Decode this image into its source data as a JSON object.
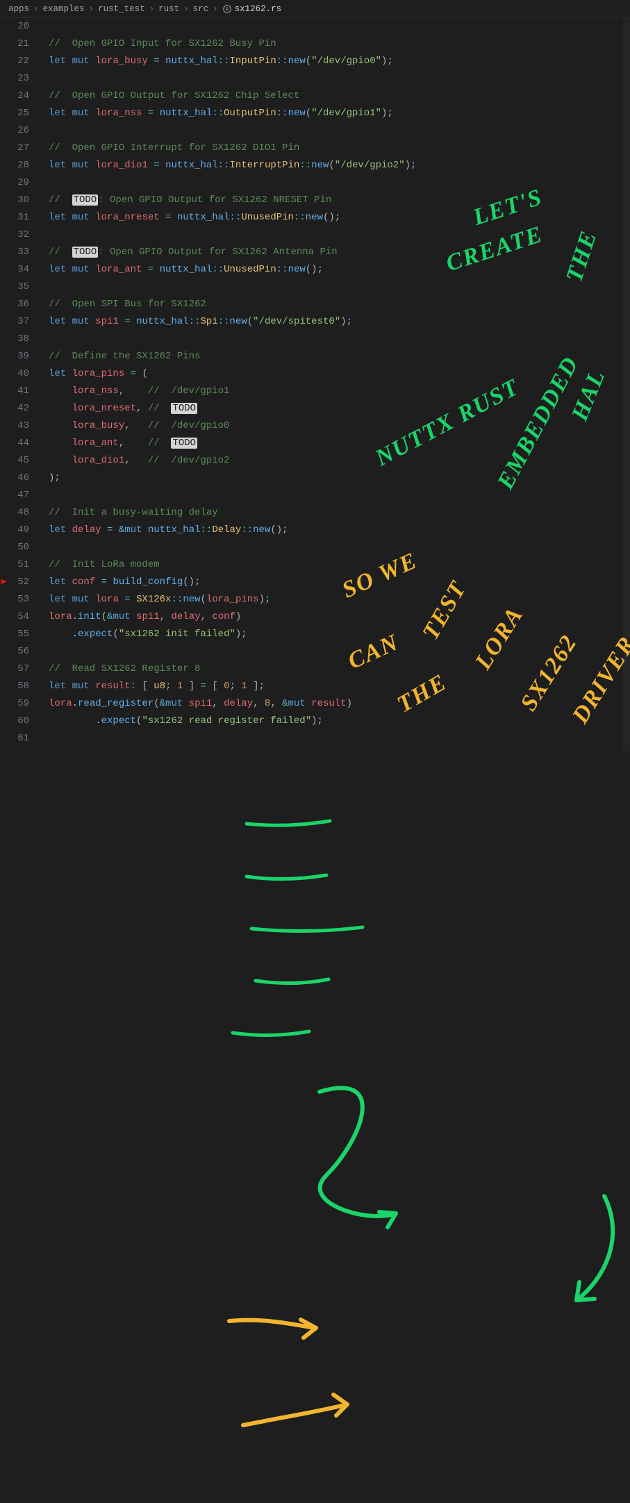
{
  "breadcrumb": {
    "parts": [
      "apps",
      "examples",
      "rust_test",
      "rust",
      "src"
    ],
    "file": "sx1262.rs"
  },
  "gutter": {
    "start": 20,
    "end": 61
  },
  "breakpoint_line": 52,
  "code": {
    "20": [],
    "21": [
      [
        "c",
        "//  Open GPIO Input for SX1262 Busy Pin"
      ]
    ],
    "22": [
      [
        "kw",
        "let"
      ],
      [
        "pn",
        " "
      ],
      [
        "kw",
        "mut"
      ],
      [
        "pn",
        " "
      ],
      [
        "id",
        "lora_busy"
      ],
      [
        "pn",
        " "
      ],
      [
        "op",
        "="
      ],
      [
        "pn",
        " "
      ],
      [
        "ns",
        "nuttx_hal"
      ],
      [
        "op",
        "::"
      ],
      [
        "ty",
        "InputPin"
      ],
      [
        "op",
        "::"
      ],
      [
        "fn",
        "new"
      ],
      [
        "pn",
        "("
      ],
      [
        "st",
        "\"/dev/gpio0\""
      ],
      [
        "pn",
        ");"
      ]
    ],
    "23": [],
    "24": [
      [
        "c",
        "//  Open GPIO Output for SX1262 Chip Select"
      ]
    ],
    "25": [
      [
        "kw",
        "let"
      ],
      [
        "pn",
        " "
      ],
      [
        "kw",
        "mut"
      ],
      [
        "pn",
        " "
      ],
      [
        "id",
        "lora_nss"
      ],
      [
        "pn",
        " "
      ],
      [
        "op",
        "="
      ],
      [
        "pn",
        " "
      ],
      [
        "ns",
        "nuttx_hal"
      ],
      [
        "op",
        "::"
      ],
      [
        "ty",
        "OutputPin"
      ],
      [
        "op",
        "::"
      ],
      [
        "fn",
        "new"
      ],
      [
        "pn",
        "("
      ],
      [
        "st",
        "\"/dev/gpio1\""
      ],
      [
        "pn",
        ");"
      ]
    ],
    "26": [],
    "27": [
      [
        "c",
        "//  Open GPIO Interrupt for SX1262 DIO1 Pin"
      ]
    ],
    "28": [
      [
        "kw",
        "let"
      ],
      [
        "pn",
        " "
      ],
      [
        "kw",
        "mut"
      ],
      [
        "pn",
        " "
      ],
      [
        "id",
        "lora_dio1"
      ],
      [
        "pn",
        " "
      ],
      [
        "op",
        "="
      ],
      [
        "pn",
        " "
      ],
      [
        "ns",
        "nuttx_hal"
      ],
      [
        "op",
        "::"
      ],
      [
        "ty",
        "InterruptPin"
      ],
      [
        "op",
        "::"
      ],
      [
        "fn",
        "new"
      ],
      [
        "pn",
        "("
      ],
      [
        "st",
        "\"/dev/gpio2\""
      ],
      [
        "pn",
        ");"
      ]
    ],
    "29": [],
    "30": [
      [
        "c",
        "//  "
      ],
      [
        "todo",
        "TODO"
      ],
      [
        "c",
        ": Open GPIO Output for SX1262 NRESET Pin"
      ]
    ],
    "31": [
      [
        "kw",
        "let"
      ],
      [
        "pn",
        " "
      ],
      [
        "kw",
        "mut"
      ],
      [
        "pn",
        " "
      ],
      [
        "id",
        "lora_nreset"
      ],
      [
        "pn",
        " "
      ],
      [
        "op",
        "="
      ],
      [
        "pn",
        " "
      ],
      [
        "ns",
        "nuttx_hal"
      ],
      [
        "op",
        "::"
      ],
      [
        "ty",
        "UnusedPin"
      ],
      [
        "op",
        "::"
      ],
      [
        "fn",
        "new"
      ],
      [
        "pn",
        "();"
      ]
    ],
    "32": [],
    "33": [
      [
        "c",
        "//  "
      ],
      [
        "todo",
        "TODO"
      ],
      [
        "c",
        ": Open GPIO Output for SX1262 Antenna Pin"
      ]
    ],
    "34": [
      [
        "kw",
        "let"
      ],
      [
        "pn",
        " "
      ],
      [
        "kw",
        "mut"
      ],
      [
        "pn",
        " "
      ],
      [
        "id",
        "lora_ant"
      ],
      [
        "pn",
        " "
      ],
      [
        "op",
        "="
      ],
      [
        "pn",
        " "
      ],
      [
        "ns",
        "nuttx_hal"
      ],
      [
        "op",
        "::"
      ],
      [
        "ty",
        "UnusedPin"
      ],
      [
        "op",
        "::"
      ],
      [
        "fn",
        "new"
      ],
      [
        "pn",
        "();"
      ]
    ],
    "35": [],
    "36": [
      [
        "c",
        "//  Open SPI Bus for SX1262"
      ]
    ],
    "37": [
      [
        "kw",
        "let"
      ],
      [
        "pn",
        " "
      ],
      [
        "kw",
        "mut"
      ],
      [
        "pn",
        " "
      ],
      [
        "id",
        "spi1"
      ],
      [
        "pn",
        " "
      ],
      [
        "op",
        "="
      ],
      [
        "pn",
        " "
      ],
      [
        "ns",
        "nuttx_hal"
      ],
      [
        "op",
        "::"
      ],
      [
        "ty",
        "Spi"
      ],
      [
        "op",
        "::"
      ],
      [
        "fn",
        "new"
      ],
      [
        "pn",
        "("
      ],
      [
        "st",
        "\"/dev/spitest0\""
      ],
      [
        "pn",
        ");"
      ]
    ],
    "38": [],
    "39": [
      [
        "c",
        "//  Define the SX1262 Pins"
      ]
    ],
    "40": [
      [
        "kw",
        "let"
      ],
      [
        "pn",
        " "
      ],
      [
        "id",
        "lora_pins"
      ],
      [
        "pn",
        " "
      ],
      [
        "op",
        "="
      ],
      [
        "pn",
        " ("
      ]
    ],
    "41": [
      [
        "pn",
        "    "
      ],
      [
        "id",
        "lora_nss"
      ],
      [
        "pn",
        ",    "
      ],
      [
        "c",
        "//  /dev/gpio1"
      ]
    ],
    "42": [
      [
        "pn",
        "    "
      ],
      [
        "id",
        "lora_nreset"
      ],
      [
        "pn",
        ", "
      ],
      [
        "c",
        "//  "
      ],
      [
        "todo",
        "TODO"
      ]
    ],
    "43": [
      [
        "pn",
        "    "
      ],
      [
        "id",
        "lora_busy"
      ],
      [
        "pn",
        ",   "
      ],
      [
        "c",
        "//  /dev/gpio0"
      ]
    ],
    "44": [
      [
        "pn",
        "    "
      ],
      [
        "id",
        "lora_ant"
      ],
      [
        "pn",
        ",    "
      ],
      [
        "c",
        "//  "
      ],
      [
        "todo",
        "TODO"
      ]
    ],
    "45": [
      [
        "pn",
        "    "
      ],
      [
        "id",
        "lora_dio1"
      ],
      [
        "pn",
        ",   "
      ],
      [
        "c",
        "//  /dev/gpio2"
      ]
    ],
    "46": [
      [
        "pn",
        ");"
      ]
    ],
    "47": [],
    "48": [
      [
        "c",
        "//  Init a busy-waiting delay"
      ]
    ],
    "49": [
      [
        "kw",
        "let"
      ],
      [
        "pn",
        " "
      ],
      [
        "id",
        "delay"
      ],
      [
        "pn",
        " "
      ],
      [
        "op",
        "="
      ],
      [
        "pn",
        " "
      ],
      [
        "op",
        "&"
      ],
      [
        "kw",
        "mut"
      ],
      [
        "pn",
        " "
      ],
      [
        "ns",
        "nuttx_hal"
      ],
      [
        "op",
        "::"
      ],
      [
        "ty",
        "Delay"
      ],
      [
        "op",
        "::"
      ],
      [
        "fn",
        "new"
      ],
      [
        "pn",
        "();"
      ]
    ],
    "50": [],
    "51": [
      [
        "c",
        "//  Init LoRa modem"
      ]
    ],
    "52": [
      [
        "kw",
        "let"
      ],
      [
        "pn",
        " "
      ],
      [
        "id",
        "conf"
      ],
      [
        "pn",
        " "
      ],
      [
        "op",
        "="
      ],
      [
        "pn",
        " "
      ],
      [
        "fn",
        "build_config"
      ],
      [
        "pn",
        "();"
      ]
    ],
    "53": [
      [
        "kw",
        "let"
      ],
      [
        "pn",
        " "
      ],
      [
        "kw",
        "mut"
      ],
      [
        "pn",
        " "
      ],
      [
        "id",
        "lora"
      ],
      [
        "pn",
        " "
      ],
      [
        "op",
        "="
      ],
      [
        "pn",
        " "
      ],
      [
        "ty",
        "SX126x"
      ],
      [
        "op",
        "::"
      ],
      [
        "fn",
        "new"
      ],
      [
        "pn",
        "("
      ],
      [
        "id",
        "lora_pins"
      ],
      [
        "pn",
        ");"
      ]
    ],
    "54": [
      [
        "id",
        "lora"
      ],
      [
        "pn",
        "."
      ],
      [
        "fn",
        "init"
      ],
      [
        "pn",
        "("
      ],
      [
        "op",
        "&"
      ],
      [
        "kw",
        "mut"
      ],
      [
        "pn",
        " "
      ],
      [
        "id",
        "spi1"
      ],
      [
        "pn",
        ", "
      ],
      [
        "id",
        "delay"
      ],
      [
        "pn",
        ", "
      ],
      [
        "id",
        "conf"
      ],
      [
        "pn",
        ")"
      ]
    ],
    "55": [
      [
        "pn",
        "    ."
      ],
      [
        "fn",
        "expect"
      ],
      [
        "pn",
        "("
      ],
      [
        "st",
        "\"sx1262 init failed\""
      ],
      [
        "pn",
        ");"
      ]
    ],
    "56": [],
    "57": [
      [
        "c",
        "//  Read SX1262 Register 8"
      ]
    ],
    "58": [
      [
        "kw",
        "let"
      ],
      [
        "pn",
        " "
      ],
      [
        "kw",
        "mut"
      ],
      [
        "pn",
        " "
      ],
      [
        "id",
        "result"
      ],
      [
        "op",
        ":"
      ],
      [
        "pn",
        " [ "
      ],
      [
        "ty",
        "u8"
      ],
      [
        "pn",
        "; "
      ],
      [
        "nu",
        "1"
      ],
      [
        "pn",
        " ] "
      ],
      [
        "op",
        "="
      ],
      [
        "pn",
        " [ "
      ],
      [
        "nu",
        "0"
      ],
      [
        "pn",
        "; "
      ],
      [
        "nu",
        "1"
      ],
      [
        "pn",
        " ];"
      ]
    ],
    "59": [
      [
        "id",
        "lora"
      ],
      [
        "pn",
        "."
      ],
      [
        "fn",
        "read_register"
      ],
      [
        "pn",
        "("
      ],
      [
        "op",
        "&"
      ],
      [
        "kw",
        "mut"
      ],
      [
        "pn",
        " "
      ],
      [
        "id",
        "spi1"
      ],
      [
        "pn",
        ", "
      ],
      [
        "id",
        "delay"
      ],
      [
        "pn",
        ", "
      ],
      [
        "nu",
        "8"
      ],
      [
        "pn",
        ", "
      ],
      [
        "op",
        "&"
      ],
      [
        "kw",
        "mut"
      ],
      [
        "pn",
        " "
      ],
      [
        "id",
        "result"
      ],
      [
        "pn",
        ")"
      ]
    ],
    "60": [
      [
        "pn",
        "        ."
      ],
      [
        "fn",
        "expect"
      ],
      [
        "pn",
        "("
      ],
      [
        "st",
        "\"sx1262 read register failed\""
      ],
      [
        "pn",
        ");"
      ]
    ],
    "61": []
  },
  "annotations": {
    "green_lines": [
      "LET'S",
      "CREATE",
      "THE",
      "NUTTX RUST",
      "EMBEDDED",
      "HAL"
    ],
    "yellow_lines": [
      "SO WE",
      "CAN",
      "TEST",
      "THE",
      "LORA",
      "SX1262",
      "DRIVER"
    ]
  }
}
